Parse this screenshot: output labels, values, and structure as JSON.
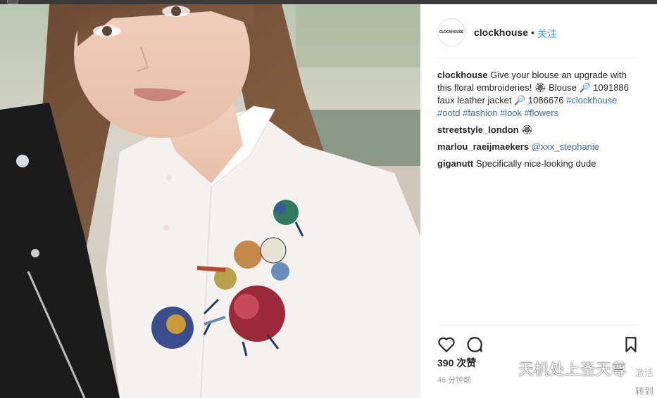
{
  "post": {
    "username": "clockhouse",
    "avatar_text": "CLOCKHOUSE",
    "separator": "•",
    "follow_label": "关注",
    "likes": "390 次赞",
    "time": "46 分钟前"
  },
  "comments": [
    {
      "user": "clockhouse",
      "text_parts": [
        "Give your blouse an upgrade with this floral embroideries! 🏵 Blouse 🔎 1091886 faux leather jacket 🔎 1086676 "
      ],
      "tags": [
        "#clockhouse",
        "#ootd",
        "#fashion",
        "#look",
        "#flowers"
      ]
    },
    {
      "user": "streetstyle_london",
      "text": "🏵"
    },
    {
      "user": "marlou_raeijmaekers",
      "mention": "@xxx_stephanie"
    },
    {
      "user": "giganutt",
      "text": "Specifically nice-looking dude"
    }
  ],
  "watermark": {
    "main": "天机处上圣天尊",
    "right_top": "激活",
    "right_bottom": "转到"
  },
  "colors": {
    "link": "#3897f0",
    "hashtag": "#3b6ba8",
    "text": "#262626",
    "muted": "#999999"
  },
  "icons": [
    "heart-icon",
    "comment-icon",
    "bookmark-icon",
    "wechat-icon"
  ]
}
